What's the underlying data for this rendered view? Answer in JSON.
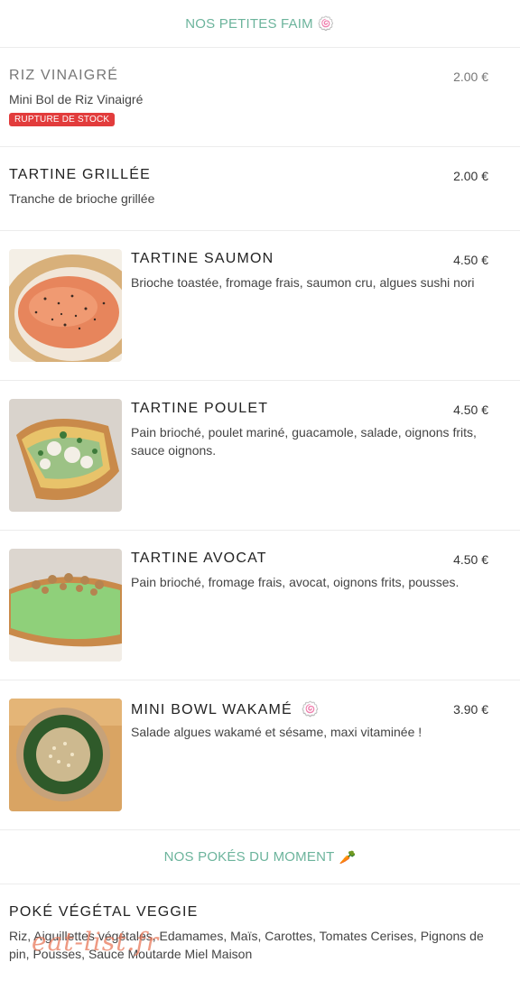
{
  "sections": [
    {
      "title": "NOS PETITES FAIM",
      "emoji": "🍥"
    },
    {
      "title": "NOS POKÉS DU MOMENT",
      "emoji": "🥕"
    }
  ],
  "items": [
    {
      "name": "RIZ VINAIGRÉ",
      "price": "2.00 €",
      "description": "Mini Bol de Riz Vinaigré",
      "badge": "RUPTURE DE STOCK"
    },
    {
      "name": "TARTINE GRILLÉE",
      "price": "2.00 €",
      "description": "Tranche de brioche grillée"
    },
    {
      "name": "TARTINE SAUMON",
      "price": "4.50 €",
      "description": "Brioche toastée, fromage frais, saumon cru, algues sushi nori",
      "image": "salmon-toast-photo"
    },
    {
      "name": "TARTINE POULET",
      "price": "4.50 €",
      "description_lines": [
        "Pain brioché, poulet mariné, guacamole, salade, oignons frits,",
        "sauce oignons."
      ],
      "image": "chicken-toast-photo"
    },
    {
      "name": "TARTINE AVOCAT",
      "price": "4.50 €",
      "description": "Pain brioché, fromage frais, avocat, oignons frits, pousses.",
      "image": "avocado-toast-photo"
    },
    {
      "name": "MINI BOWL WAKAMÉ",
      "emoji": "🍥",
      "price": "3.90 €",
      "description": "Salade algues wakamé et sésame, maxi vitaminée !",
      "image": "wakame-bowl-photo"
    },
    {
      "name": "POKÉ VÉGÉTAL VEGGIE",
      "description_lines": [
        "Riz, Aiguillettes végétales, Edamames, Maïs, Carottes, Tomates Cerises, Pignons de",
        "pin, Pousses, Sauce Moutarde Miel Maison"
      ]
    }
  ],
  "watermark": "eat-list.fr",
  "colors": {
    "section_title": "#6cb49c",
    "badge": "#e23c3c",
    "divider": "#ececec"
  }
}
